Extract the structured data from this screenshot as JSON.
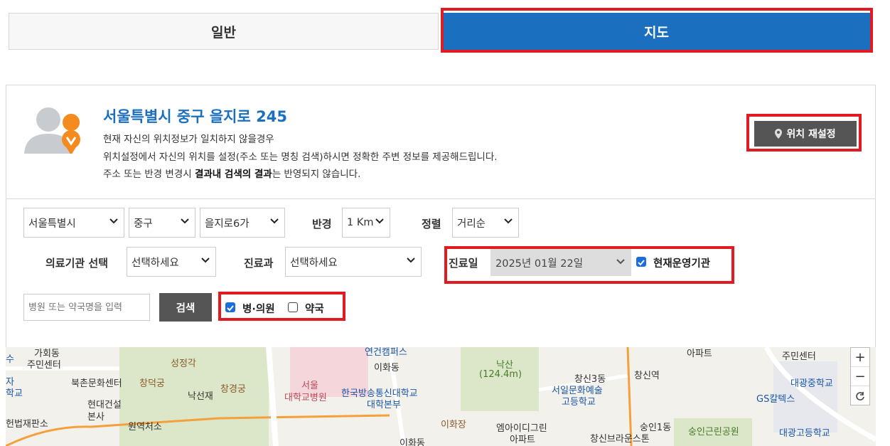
{
  "tabs": {
    "general": "일반",
    "map": "지도"
  },
  "location": {
    "address": "서울특별시 중구 을지로 245",
    "desc_line1": "현재 자신의 위치정보가 일치하지 않을경우",
    "desc_line2": "위치설정에서 자신의 위치를 설정(주소 또는 명칭 검색)하시면 정확한 주변 정보를 제공해드립니다.",
    "desc_line3_pre": "주소 또는 반경 변경시 ",
    "desc_line3_bold": "결과내 검색의 결과",
    "desc_line3_post": "는 반영되지 않습니다.",
    "relocate_label": "위치 재설정"
  },
  "filters": {
    "city": "서울특별시",
    "district": "중구",
    "dong": "을지로6가",
    "radius_label": "반경",
    "radius": "1 Km",
    "sort_label": "정렬",
    "sort": "거리순",
    "institution_label": "의료기관 선택",
    "institution": "선택하세요",
    "dept_label": "진료과",
    "dept": "선택하세요",
    "date_label": "진료일",
    "date": "2025년 01월 22일",
    "operating_label": "현재운영기관",
    "operating_checked": true,
    "search_placeholder": "병원 또는 약국명을 입력",
    "search_button": "검색",
    "hospital_label": "병·의원",
    "hospital_checked": true,
    "pharmacy_label": "약국",
    "pharmacy_checked": false
  },
  "map": {
    "labels": [
      "가회동",
      "주민센터",
      "북촌문화센터",
      "현대건설",
      "본사",
      "헌법재판소",
      "성정각",
      "창덕궁",
      "창경궁",
      "낙선재",
      "원역처소",
      "연건캠퍼스",
      "이화동",
      "서울",
      "대학교병원",
      "한국방송통신대학교",
      "대학본부",
      "이화장",
      "낙산",
      "(124.4m)",
      "서일문화예술",
      "고등학교",
      "엠아이디그린",
      "아파트",
      "창신역",
      "숭인1동",
      "창신브라운스톤",
      "아파트",
      "숭인근린공원",
      "주민센터",
      "대광중학교",
      "GS칼텍스",
      "대광고등학교",
      "수",
      "자",
      "학교",
      "이화동",
      "창신3동"
    ],
    "zoom_in": "+",
    "zoom_out": "−"
  }
}
